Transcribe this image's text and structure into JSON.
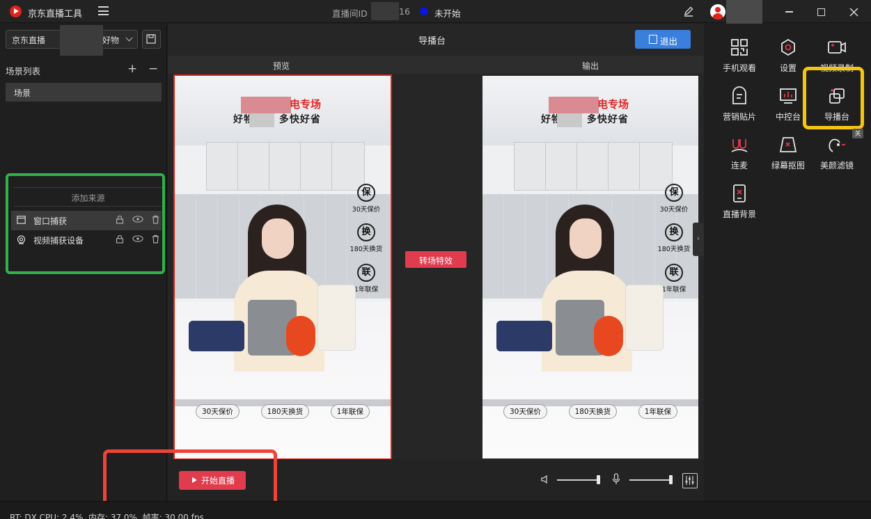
{
  "app": {
    "title": "京东直播工具",
    "room_label": "直播间ID",
    "room_suffix": "16",
    "status": "未开始",
    "status_color": "#0a17d8"
  },
  "left": {
    "platform_select": "京东直播",
    "category_select": "好物",
    "scene_list_title": "场景列表",
    "scenes": [
      "场景"
    ],
    "add_source_label": "添加来源",
    "sources": [
      {
        "label": "窗口捕获",
        "icon": "window-icon",
        "active": true
      },
      {
        "label": "视频捕获设备",
        "icon": "camera-icon",
        "active": false
      }
    ]
  },
  "center": {
    "title": "导播台",
    "exit_label": "退出",
    "preview_label": "预览",
    "output_label": "输出",
    "transition_label": "转场特效",
    "start_label": "开始直播",
    "frame": {
      "banner_title": "电专场",
      "slogan": "好物聚惠 多快好省",
      "badges": [
        {
          "char": "保",
          "text": "30天保价"
        },
        {
          "char": "换",
          "text": "180天换货"
        },
        {
          "char": "联",
          "text": "1年联保"
        }
      ],
      "pills": [
        "30天保价",
        "180天换货",
        "1年联保"
      ]
    },
    "volume_level": 0.95,
    "mic_level": 0.95
  },
  "tools": [
    {
      "label": "手机观看",
      "icon": "qr-phone-icon"
    },
    {
      "label": "设置",
      "icon": "settings-icon"
    },
    {
      "label": "视频录制",
      "icon": "video-record-icon"
    },
    {
      "label": "营销贴片",
      "icon": "sticker-icon"
    },
    {
      "label": "中控台",
      "icon": "dashboard-icon"
    },
    {
      "label": "导播台",
      "icon": "director-icon"
    },
    {
      "label": "连麦",
      "icon": "co-host-icon"
    },
    {
      "label": "绿幕抠图",
      "icon": "green-screen-icon"
    },
    {
      "label": "美颜滤镜",
      "icon": "beauty-filter-icon"
    },
    {
      "label": "直播背景",
      "icon": "live-background-icon"
    }
  ],
  "new_tag": "关",
  "status_bar": "RT: DX CPU: 2.4%, 内存: 37.0%, 帧率: 30.00 fps",
  "colors": {
    "accent_red": "#e13b4e",
    "accent_blue": "#3a7fdb",
    "highlight_green": "#32b04a",
    "highlight_yellow": "#f6c511",
    "highlight_red": "#ee4437"
  }
}
